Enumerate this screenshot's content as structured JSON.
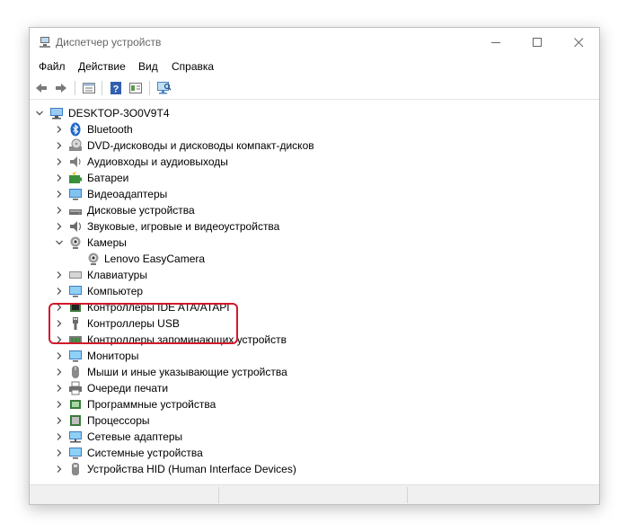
{
  "window": {
    "title": "Диспетчер устройств",
    "accent_color": "#d11a2a"
  },
  "menu": [
    "Файл",
    "Действие",
    "Вид",
    "Справка"
  ],
  "toolbar": {
    "icons": [
      "back-arrow-icon",
      "forward-arrow-icon",
      "properties-icon",
      "help-icon",
      "update-driver-icon",
      "scan-hardware-icon"
    ]
  },
  "tree": {
    "root": "DESKTOP-3O0V9T4",
    "items": [
      {
        "label": "Bluetooth",
        "icon": "bluetooth-icon",
        "expanded": false
      },
      {
        "label": "DVD-дисководы и дисководы компакт-дисков",
        "icon": "dvd-drive-icon",
        "expanded": false
      },
      {
        "label": "Аудиовходы и аудиовыходы",
        "icon": "audio-icon",
        "expanded": false
      },
      {
        "label": "Батареи",
        "icon": "battery-icon",
        "expanded": false
      },
      {
        "label": "Видеоадаптеры",
        "icon": "display-adapter-icon",
        "expanded": false
      },
      {
        "label": "Дисковые устройства",
        "icon": "disk-drive-icon",
        "expanded": false
      },
      {
        "label": "Звуковые, игровые и видеоустройства",
        "icon": "sound-icon",
        "expanded": false
      },
      {
        "label": "Камеры",
        "icon": "camera-icon",
        "expanded": true
      },
      {
        "label": "Lenovo EasyCamera",
        "icon": "webcam-icon",
        "child": true
      },
      {
        "label": "Клавиатуры",
        "icon": "keyboard-icon",
        "expanded": false
      },
      {
        "label": "Компьютер",
        "icon": "computer-icon",
        "expanded": false
      },
      {
        "label": "Контроллеры IDE ATA/ATAPI",
        "icon": "ide-controller-icon",
        "expanded": false
      },
      {
        "label": "Контроллеры USB",
        "icon": "usb-icon",
        "expanded": false
      },
      {
        "label": "Контроллеры запоминающих устройств",
        "icon": "storage-controller-icon",
        "expanded": false
      },
      {
        "label": "Мониторы",
        "icon": "monitor-icon",
        "expanded": false
      },
      {
        "label": "Мыши и иные указывающие устройства",
        "icon": "mouse-icon",
        "expanded": false
      },
      {
        "label": "Очереди печати",
        "icon": "printer-icon",
        "expanded": false
      },
      {
        "label": "Программные устройства",
        "icon": "software-device-icon",
        "expanded": false
      },
      {
        "label": "Процессоры",
        "icon": "processor-icon",
        "expanded": false
      },
      {
        "label": "Сетевые адаптеры",
        "icon": "network-adapter-icon",
        "expanded": false
      },
      {
        "label": "Системные устройства",
        "icon": "system-device-icon",
        "expanded": false
      },
      {
        "label": "Устройства HID (Human Interface Devices)",
        "icon": "hid-icon",
        "expanded": false
      }
    ]
  }
}
